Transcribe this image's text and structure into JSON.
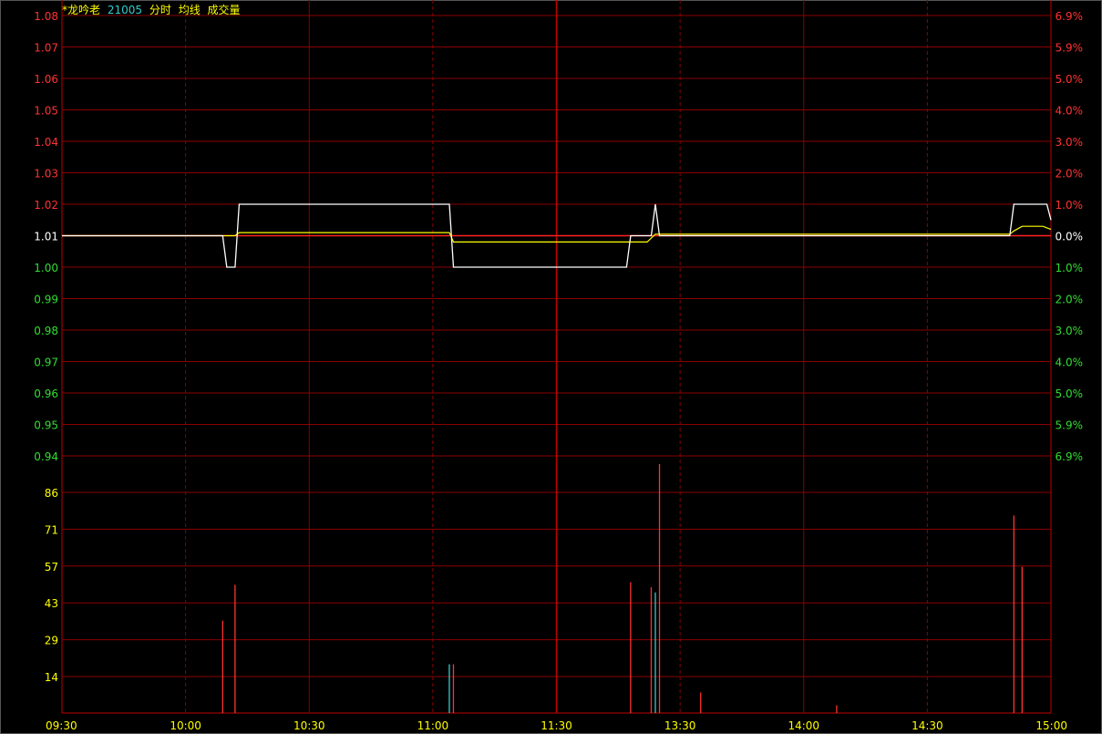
{
  "header": {
    "stock_name": "*龙吟老",
    "code": "21005",
    "mode": "分时",
    "avg_label": "均线",
    "vol_label": "成交量"
  },
  "colors": {
    "background": "#000000",
    "grid": "#8b0000",
    "axis": "#c00000",
    "price_line": "#ffffff",
    "avg_line": "#ffff00",
    "up": "#ff3333",
    "down": "#33dd33",
    "volume_up": "#ff3333",
    "volume_down": "#33cccc",
    "volume_label": "#ffff00",
    "time_label": "#ffff00"
  },
  "chart_data": {
    "type": "line",
    "prev_close": 1.01,
    "y_price_ticks": [
      "1.08",
      "1.07",
      "1.06",
      "1.05",
      "1.04",
      "1.03",
      "1.02",
      "1.01",
      "1.00",
      "0.99",
      "0.98",
      "0.97",
      "0.96",
      "0.95",
      "0.94"
    ],
    "y_percent_ticks": [
      "6.9%",
      "5.9%",
      "5.0%",
      "4.0%",
      "3.0%",
      "2.0%",
      "1.0%",
      "0.0%",
      "1.0%",
      "2.0%",
      "3.0%",
      "4.0%",
      "5.0%",
      "5.9%",
      "6.9%"
    ],
    "price_ylim": [
      0.94,
      1.08
    ],
    "x_ticks": [
      "09:30",
      "10:00",
      "10:30",
      "11:00",
      "11:30",
      "13:30",
      "14:00",
      "14:30",
      "15:00"
    ],
    "minutes_total": 240,
    "price_series": {
      "name": "分时",
      "points": [
        [
          0,
          1.01
        ],
        [
          39,
          1.01
        ],
        [
          40,
          1.0
        ],
        [
          42,
          1.0
        ],
        [
          43,
          1.02
        ],
        [
          94,
          1.02
        ],
        [
          95,
          1.0
        ],
        [
          137,
          1.0
        ],
        [
          138,
          1.01
        ],
        [
          143,
          1.01
        ],
        [
          144,
          1.02
        ],
        [
          145,
          1.01
        ],
        [
          230,
          1.01
        ],
        [
          231,
          1.02
        ],
        [
          239,
          1.02
        ],
        [
          240,
          1.015
        ]
      ]
    },
    "avg_series": {
      "name": "均线",
      "points": [
        [
          0,
          1.01
        ],
        [
          42,
          1.01
        ],
        [
          43,
          1.011
        ],
        [
          94,
          1.011
        ],
        [
          95,
          1.008
        ],
        [
          142,
          1.008
        ],
        [
          144,
          1.0105
        ],
        [
          230,
          1.0105
        ],
        [
          231,
          1.0115
        ],
        [
          233,
          1.013
        ],
        [
          238,
          1.013
        ],
        [
          240,
          1.012
        ]
      ]
    },
    "volume_ticks": [
      "86",
      "71",
      "57",
      "43",
      "29",
      "14"
    ],
    "volume_ylim": [
      0,
      100
    ],
    "volume_bars": [
      {
        "t": 39,
        "v": 36,
        "dir": "up"
      },
      {
        "t": 42,
        "v": 50,
        "dir": "up"
      },
      {
        "t": 94,
        "v": 19,
        "dir": "down"
      },
      {
        "t": 95,
        "v": 19,
        "dir": "up"
      },
      {
        "t": 138,
        "v": 51,
        "dir": "up"
      },
      {
        "t": 143,
        "v": 49,
        "dir": "up"
      },
      {
        "t": 144,
        "v": 47,
        "dir": "down"
      },
      {
        "t": 145,
        "v": 97,
        "dir": "up"
      },
      {
        "t": 155,
        "v": 8,
        "dir": "up"
      },
      {
        "t": 188,
        "v": 3,
        "dir": "up"
      },
      {
        "t": 231,
        "v": 77,
        "dir": "up"
      },
      {
        "t": 233,
        "v": 57,
        "dir": "up"
      }
    ]
  }
}
